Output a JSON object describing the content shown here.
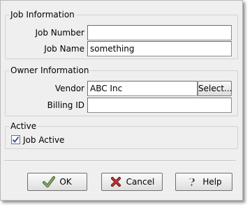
{
  "job_info": {
    "legend": "Job Information",
    "job_number_label": "Job Number",
    "job_number_value": "",
    "job_name_label": "Job Name",
    "job_name_value": "something"
  },
  "owner_info": {
    "legend": "Owner Information",
    "vendor_label": "Vendor",
    "vendor_value": "ABC Inc",
    "select_label": "Select...",
    "billing_id_label": "Billing ID",
    "billing_id_value": ""
  },
  "active": {
    "legend": "Active",
    "checkbox_label": "Job Active",
    "checked": true
  },
  "buttons": {
    "ok_label": "OK",
    "ok_icon": "checkmark-icon",
    "cancel_label": "Cancel",
    "cancel_icon": "x-icon",
    "help_label": "Help",
    "help_icon": "question-icon"
  },
  "colors": {
    "dialog_bg": "#efefef",
    "ok_icon": "#5a7a3a",
    "cancel_icon": "#8a1c1c",
    "check_mark": "#2b4a9a"
  }
}
